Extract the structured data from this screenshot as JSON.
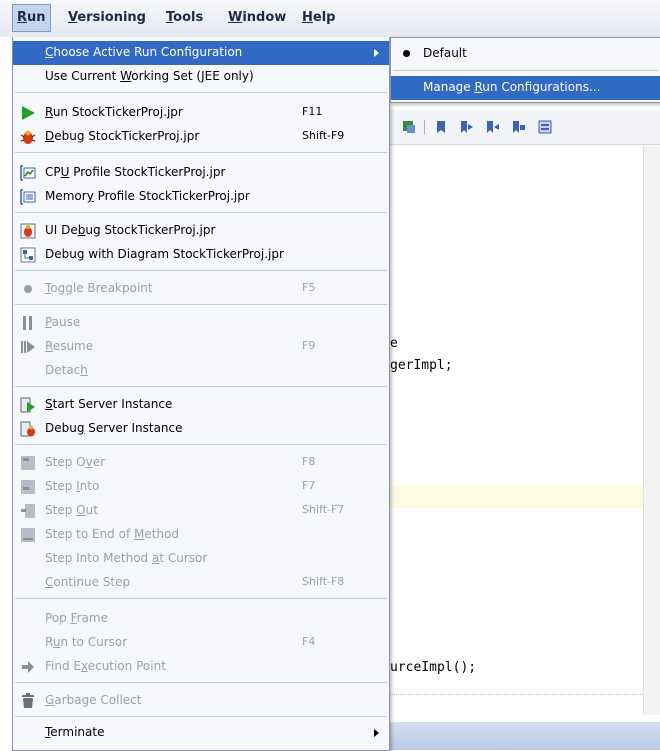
{
  "menubar": [
    {
      "label": "Run",
      "key": "R",
      "rest": "un"
    },
    {
      "label": "Versioning",
      "key": "V",
      "rest": "ersioning"
    },
    {
      "label": "Tools",
      "key": "T",
      "rest": "ools"
    },
    {
      "label": "Window",
      "key": "W",
      "rest": "indow"
    },
    {
      "label": "Help",
      "key": "H",
      "rest": "elp"
    }
  ],
  "menu": {
    "choose_active": {
      "pre": "",
      "key": "C",
      "post": "hoose Active Run Configuration"
    },
    "use_current": {
      "pre": "Use Current ",
      "key": "W",
      "post": "orking Set (JEE only)"
    },
    "run_proj": {
      "pre": "",
      "key": "R",
      "post": "un StockTickerProj.jpr",
      "shortcut": "F11"
    },
    "debug_proj": {
      "pre": "",
      "key": "D",
      "post": "ebug StockTickerProj.jpr",
      "shortcut": "Shift-F9"
    },
    "cpu_profile": {
      "pre": "CP",
      "key": "U",
      "post": " Profile StockTickerProj.jpr"
    },
    "memory_profile": {
      "pre": "Memor",
      "key": "y",
      "post": " Profile StockTickerProj.jpr"
    },
    "ui_debug": {
      "pre": "UI De",
      "key": "b",
      "post": "ug StockTickerProj.jpr"
    },
    "debug_diagram": {
      "pre": "Debug with Diagram StockTickerProj.jpr",
      "key": "",
      "post": ""
    },
    "toggle_breakpoint": {
      "pre": "",
      "key": "T",
      "post": "oggle Breakpoint",
      "shortcut": "F5"
    },
    "pause": {
      "pre": "",
      "key": "P",
      "post": "ause"
    },
    "resume": {
      "pre": "",
      "key": "R",
      "post": "esume",
      "shortcut": "F9"
    },
    "detach": {
      "pre": "Detac",
      "key": "h",
      "post": ""
    },
    "start_server": {
      "pre": "",
      "key": "S",
      "post": "tart Server Instance"
    },
    "debug_server": {
      "pre": "Debu",
      "key": "g",
      "post": " Server Instance"
    },
    "step_over": {
      "pre": "Step O",
      "key": "v",
      "post": "er",
      "shortcut": "F8"
    },
    "step_into": {
      "pre": "Step ",
      "key": "I",
      "post": "nto",
      "shortcut": "F7"
    },
    "step_out": {
      "pre": "Step ",
      "key": "O",
      "post": "ut",
      "shortcut": "Shift-F7"
    },
    "step_end": {
      "pre": "Step to End of ",
      "key": "M",
      "post": "ethod"
    },
    "step_cursor": {
      "pre": "Step Into Method ",
      "key": "a",
      "post": "t Cursor"
    },
    "continue_step": {
      "pre": "",
      "key": "C",
      "post": "ontinue Step",
      "shortcut": "Shift-F8"
    },
    "pop_frame": {
      "pre": "Pop ",
      "key": "F",
      "post": "rame"
    },
    "run_cursor": {
      "pre": "R",
      "key": "u",
      "post": "n to Cursor",
      "shortcut": "F4"
    },
    "find_exec": {
      "pre": "Find E",
      "key": "x",
      "post": "ecution Point"
    },
    "garbage": {
      "pre": "",
      "key": "G",
      "post": "arbage Collect"
    },
    "terminate": {
      "pre": "",
      "key": "T",
      "post": "erminate"
    }
  },
  "submenu": {
    "default": "Default",
    "manage": {
      "pre": "Manage ",
      "key": "R",
      "post": "un Configurations..."
    }
  },
  "code": {
    "line1": "e",
    "line2": "gerImpl;",
    "line3": "urceImpl();"
  },
  "colors": {
    "highlight": "#316ac5",
    "disabled": "#9aa0aa",
    "menu_bg": "#f7f8fb"
  }
}
